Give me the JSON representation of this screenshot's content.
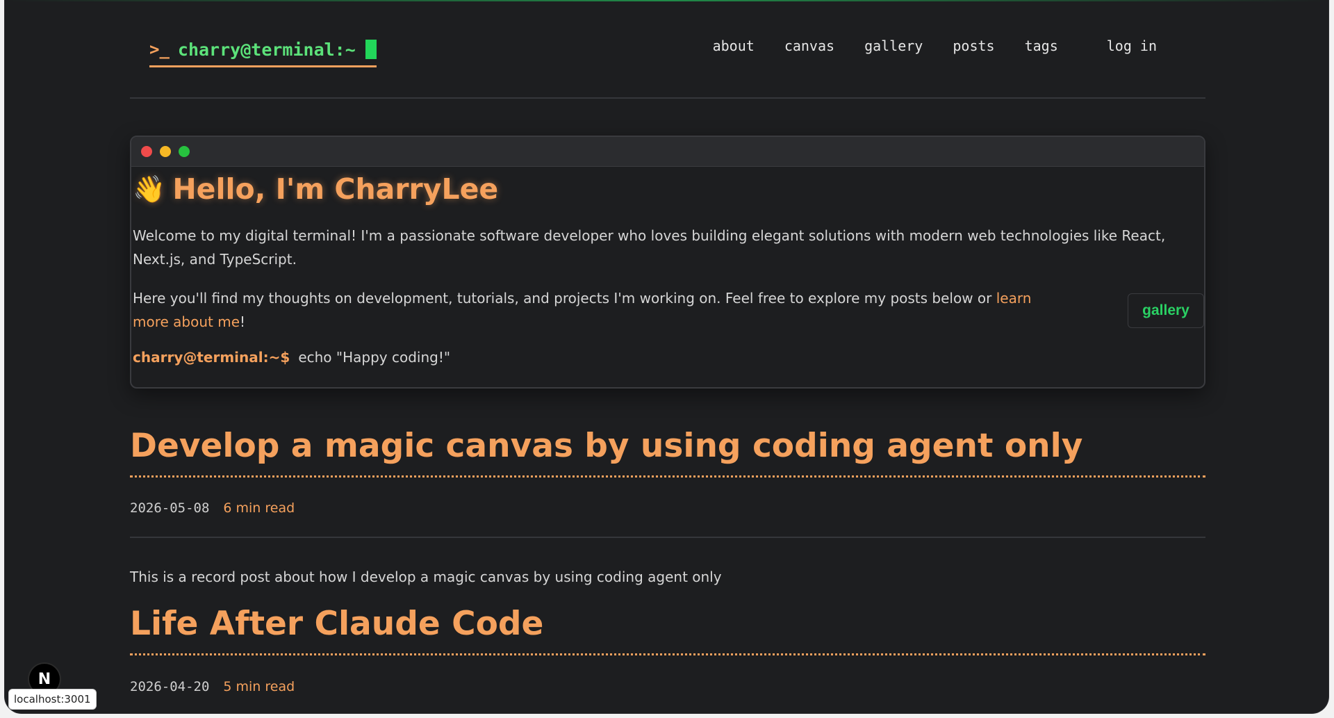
{
  "header": {
    "brand_icon": "terminal-prompt-icon",
    "brand_text": "charry@terminal:~",
    "nav": {
      "about": "about",
      "canvas": "canvas",
      "gallery": "gallery",
      "posts": "posts",
      "tags": "tags",
      "login": "log in"
    }
  },
  "intro": {
    "wave": "👋",
    "title": "Hello, I'm CharryLee",
    "para1": "Welcome to my digital terminal! I'm a passionate software developer who loves building elegant solutions with modern web technologies like React, Next.js, and TypeScript.",
    "para2_start": "Here you'll find my thoughts on development, tutorials, and projects I'm working on. Feel free to explore my posts below or ",
    "para2_link": "learn more about me",
    "para2_end": "!",
    "cmd_prompt": "charry@terminal:~$",
    "cmd_text": "echo \"Happy coding!\"",
    "gallery_button": "gallery"
  },
  "posts": [
    {
      "title": "Develop a magic canvas by using coding agent only",
      "date": "2026-05-08",
      "read_time": "6 min read",
      "excerpt": "This is a record post about how I develop a magic canvas by using coding agent only"
    },
    {
      "title": "Life After Claude Code",
      "date": "2026-04-20",
      "read_time": "5 min read"
    }
  ],
  "dev": {
    "badge": "N",
    "url": "localhost:3001"
  },
  "colors": {
    "background": "#1d1e20",
    "accent_orange": "#f5a15d",
    "accent_green": "#5ce27a"
  }
}
